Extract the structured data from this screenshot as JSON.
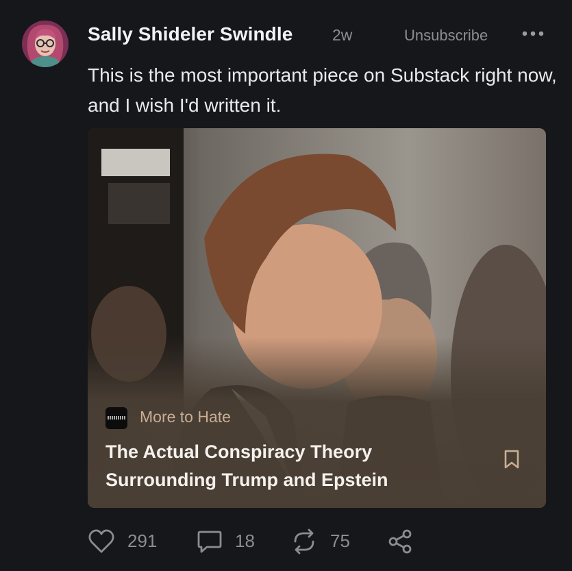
{
  "post": {
    "author": "Sally Shideler Swindle",
    "time_ago": "2w",
    "unsubscribe_label": "Unsubscribe",
    "body": "This is the most important piece on Substack right now, and I wish I'd written it."
  },
  "card": {
    "publication": "More to Hate",
    "title_line1": "The Actual Conspiracy Theory",
    "title_line2": "Surrounding Trump and Epstein"
  },
  "actions": {
    "likes": "291",
    "comments": "18",
    "restacks": "75"
  },
  "icons": {
    "more": "more-dots-icon",
    "bookmark": "bookmark-icon",
    "like": "heart-icon",
    "comment": "comment-icon",
    "restack": "restack-icon",
    "share": "share-icon"
  },
  "colors": {
    "background": "#16171a",
    "card_background": "#4a3f34",
    "publication_accent": "#c9ae96",
    "muted_text": "#8c8d92"
  }
}
